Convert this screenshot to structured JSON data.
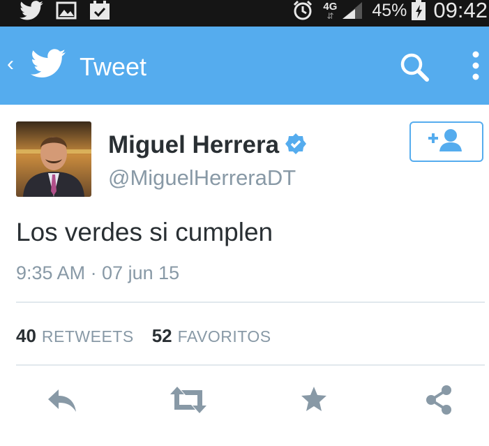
{
  "status_bar": {
    "network": "4G",
    "battery": "45%",
    "time": "09:42",
    "icons": [
      "twitter-icon",
      "image-icon",
      "calendar-check-icon",
      "alarm-icon",
      "signal-icon",
      "battery-icon"
    ]
  },
  "app_bar": {
    "back_glyph": "‹",
    "title": "Tweet",
    "color": "#55acee",
    "icons": [
      "twitter-bird-icon",
      "search-icon",
      "overflow-menu-icon"
    ]
  },
  "tweet": {
    "author_name": "Miguel Herrera",
    "handle": "@MiguelHerreraDT",
    "verified": true,
    "text": "Los verdes si cumplen",
    "timestamp": "9:35 AM · 07 jun 15",
    "follow_icon": "add-user-icon"
  },
  "stats": {
    "retweets_count": "40",
    "retweets_label": "RETWEETS",
    "favorites_count": "52",
    "favorites_label": "FAVORITOS"
  },
  "actions": [
    "reply-icon",
    "retweet-icon",
    "favorite-star-icon",
    "share-icon"
  ],
  "colors": {
    "accent": "#55acee",
    "text_primary": "#292f33",
    "text_secondary": "#8899a6",
    "action_icon": "#8899a6",
    "status_bar": "#151515"
  }
}
